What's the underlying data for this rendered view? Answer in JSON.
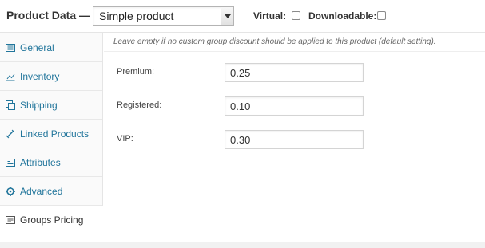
{
  "header": {
    "title": "Product Data —",
    "product_type": {
      "selected": "Simple product"
    },
    "virtual_label": "Virtual:",
    "downloadable_label": "Downloadable:"
  },
  "sidebar": {
    "tabs": [
      {
        "label": "General",
        "icon": "general-icon"
      },
      {
        "label": "Inventory",
        "icon": "inventory-icon"
      },
      {
        "label": "Shipping",
        "icon": "shipping-icon"
      },
      {
        "label": "Linked Products",
        "icon": "link-icon"
      },
      {
        "label": "Attributes",
        "icon": "attributes-icon"
      },
      {
        "label": "Advanced",
        "icon": "gear-icon"
      },
      {
        "label": "Groups Pricing",
        "icon": "groups-icon",
        "active": true
      }
    ]
  },
  "main": {
    "help_text": "Leave empty if no custom group discount should be applied to this product (default setting).",
    "fields": [
      {
        "label": "Premium:",
        "value": "0.25"
      },
      {
        "label": "Registered:",
        "value": "0.10"
      },
      {
        "label": "VIP:",
        "value": "0.30"
      }
    ]
  },
  "colors": {
    "link": "#21759b",
    "border": "#e5e5e5",
    "sidebar_bg": "#fafafa"
  }
}
